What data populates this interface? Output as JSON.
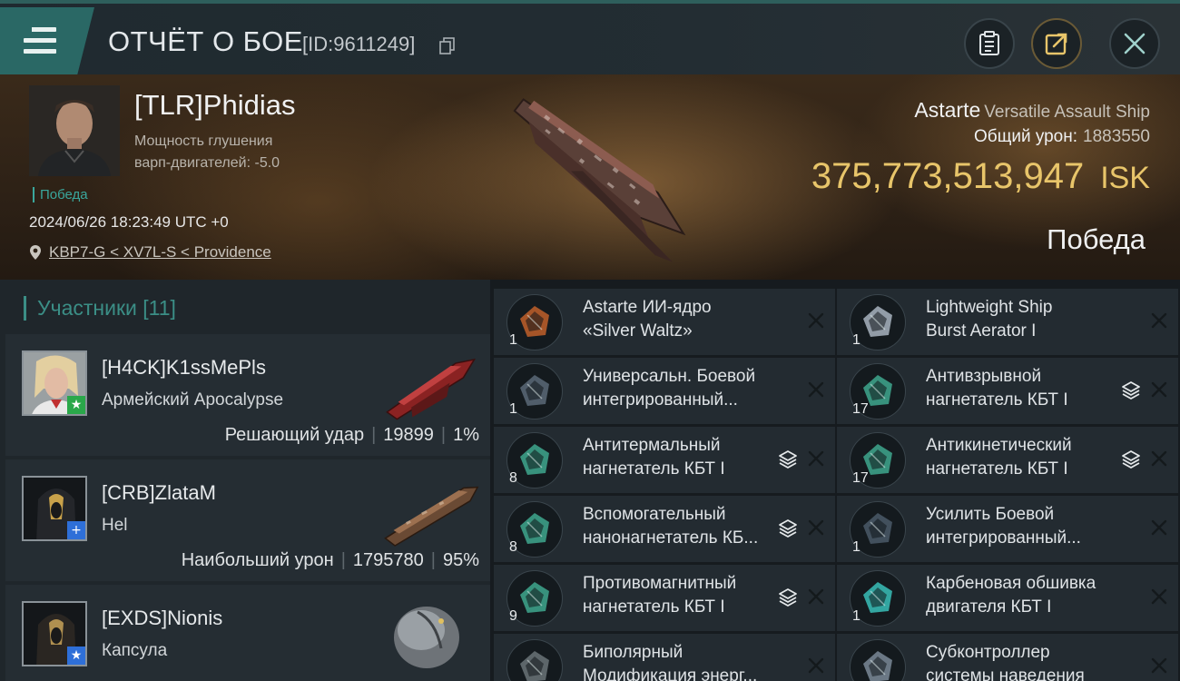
{
  "header": {
    "title": "ОТЧЁТ О БОЕ",
    "report_id": "[ID:9611249]"
  },
  "victim": {
    "name": "[TLR]Phidias",
    "attr_line1": "Мощность глушения",
    "attr_line2": "варп-двигателей: -5.0",
    "result_tag": "Победа",
    "datetime": "2024/06/26 18:23:49 UTC +0",
    "location": "KBP7-G < XV7L-S < Providence",
    "ship": "Astarte",
    "ship_class": "Versatile Assault Ship",
    "total_damage_label": "Общий урон:",
    "total_damage": "1883550",
    "isk_value": "375,773,513,947",
    "isk_unit": "ISK",
    "result": "Победа"
  },
  "participants": {
    "title": "Участники [11]",
    "items": [
      {
        "name": "[H4CK]K1ssMePls",
        "ship": "Армейский Apocalypse",
        "role": "Решающий удар",
        "damage": "19899",
        "percent": "1%",
        "badge_color": "#2aa84a"
      },
      {
        "name": "[CRB]ZlataM",
        "ship": "Hel",
        "role": "Наибольший урон",
        "damage": "1795780",
        "percent": "95%",
        "badge_color": "#2e6fd8"
      },
      {
        "name": "[EXDS]Nionis",
        "ship": "Капсула",
        "badge_color": "#2e6fd8"
      }
    ]
  },
  "modules": [
    {
      "qty": "1",
      "line1": "Astarte ИИ-ядро",
      "line2": "«Silver Waltz»",
      "stack": false
    },
    {
      "qty": "1",
      "line1": "Lightweight Ship",
      "line2": "Burst Aerator I",
      "stack": false
    },
    {
      "qty": "1",
      "line1": "Универсальн. Боевой",
      "line2": "интегрированный...",
      "stack": false
    },
    {
      "qty": "17",
      "line1": "Антивзрывной",
      "line2": "нагнетатель КБТ I",
      "stack": true
    },
    {
      "qty": "8",
      "line1": "Антитермальный",
      "line2": "нагнетатель КБТ I",
      "stack": true
    },
    {
      "qty": "17",
      "line1": "Антикинетический",
      "line2": "нагнетатель КБТ I",
      "stack": true
    },
    {
      "qty": "8",
      "line1": "Вспомогательный",
      "line2": "нанонагнетатель КБ...",
      "stack": true
    },
    {
      "qty": "1",
      "line1": "Усилить Боевой",
      "line2": "интегрированный...",
      "stack": false
    },
    {
      "qty": "9",
      "line1": "Противомагнитный",
      "line2": "нагнетатель КБТ I",
      "stack": true
    },
    {
      "qty": "1",
      "line1": "Карбеновая обшивка",
      "line2": "двигателя КБТ I",
      "stack": false
    },
    {
      "qty": "",
      "line1": "Биполярный",
      "line2": "Модификация энерг...",
      "stack": false
    },
    {
      "qty": "",
      "line1": "Субконтроллер",
      "line2": "системы наведения",
      "stack": false
    }
  ],
  "colors": {
    "accent": "#2a6865",
    "isk": "#e8c56a",
    "victory": "#3aa79c"
  }
}
